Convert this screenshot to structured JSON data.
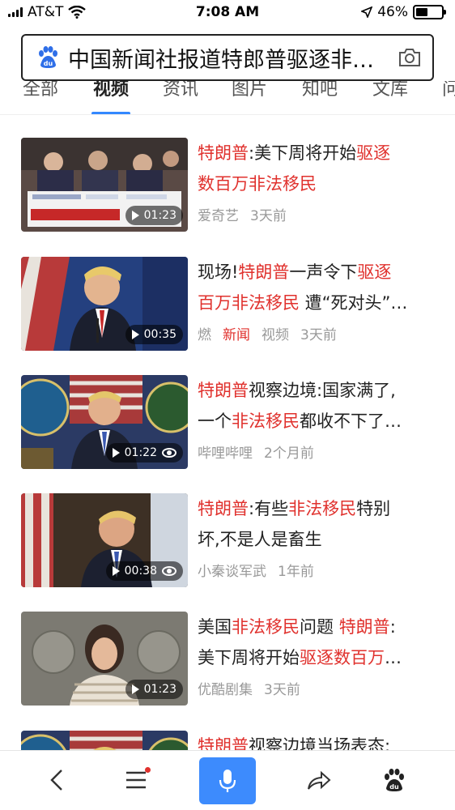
{
  "status": {
    "carrier": "AT&T",
    "time": "7:08 AM",
    "battery": "46%",
    "battery_level": 0.46
  },
  "search": {
    "query": "中国新闻社报道特郎普驱逐非法移民"
  },
  "tabs": [
    {
      "label": "全部"
    },
    {
      "label": "视频",
      "active": true
    },
    {
      "label": "资讯"
    },
    {
      "label": "图片"
    },
    {
      "label": "知吧"
    },
    {
      "label": "文库"
    },
    {
      "label": "问"
    }
  ],
  "results": [
    {
      "title_line1": [
        {
          "t": "特朗普",
          "hl": true
        },
        {
          "t": ":美下周将开始"
        },
        {
          "t": "驱逐",
          "hl": true
        }
      ],
      "title_line2": [
        {
          "t": "数百万非法移民",
          "hl": true
        }
      ],
      "source": "爱奇艺",
      "time": "3天前",
      "duration": "01:23",
      "views_icon": false,
      "thumb_theme": "hall"
    },
    {
      "title_line1": [
        {
          "t": "现场!"
        },
        {
          "t": "特朗普",
          "hl": true
        },
        {
          "t": "一声令下"
        },
        {
          "t": "驱逐",
          "hl": true
        }
      ],
      "title_line2": [
        {
          "t": "百万非法移民",
          "hl": true
        },
        {
          "t": " 遭“死对头”…"
        }
      ],
      "source_parts": [
        {
          "t": "燃"
        },
        {
          "t": "新闻",
          "hl": true
        },
        {
          "t": "视频"
        }
      ],
      "time": "3天前",
      "duration": "00:35",
      "views_icon": false,
      "thumb_theme": "flag-blue"
    },
    {
      "title_line1": [
        {
          "t": "特朗普",
          "hl": true
        },
        {
          "t": "视察边境:国家满了,"
        }
      ],
      "title_line2": [
        {
          "t": "一个"
        },
        {
          "t": "非法移民",
          "hl": true
        },
        {
          "t": "都收不下了…"
        }
      ],
      "source": "哔哩哔哩",
      "time": "2个月前",
      "duration": "01:22",
      "views_icon": true,
      "thumb_theme": "border"
    },
    {
      "title_line1": [
        {
          "t": "特朗普",
          "hl": true
        },
        {
          "t": ":有些"
        },
        {
          "t": "非法移民",
          "hl": true
        },
        {
          "t": "特别"
        }
      ],
      "title_line2": [
        {
          "t": "坏,不是人是畜生"
        }
      ],
      "source": "小秦谈军武",
      "time": "1年前",
      "duration": "00:38",
      "views_icon": true,
      "thumb_theme": "office"
    },
    {
      "title_line1": [
        {
          "t": "美国"
        },
        {
          "t": "非法移民",
          "hl": true
        },
        {
          "t": "问题 "
        },
        {
          "t": "特朗普",
          "hl": true
        },
        {
          "t": ":"
        }
      ],
      "title_line2": [
        {
          "t": "美下周将开始"
        },
        {
          "t": "驱逐数百万",
          "hl": true
        },
        {
          "t": "…"
        }
      ],
      "source": "优酷剧集",
      "time": "3天前",
      "duration": "01:23",
      "views_icon": false,
      "thumb_theme": "podium"
    },
    {
      "title_line1": [
        {
          "t": "特朗普",
          "hl": true
        },
        {
          "t": "视察边境当场表态:"
        }
      ],
      "title_line2": [],
      "source": "",
      "time": "",
      "duration": "",
      "views_icon": false,
      "thumb_theme": "border"
    }
  ],
  "bottom_nav": {
    "back_icon": "chevron-left-icon",
    "menu_icon": "menu-icon",
    "mic_icon": "microphone-icon",
    "share_icon": "share-icon",
    "home_icon": "paw-icon"
  },
  "colors": {
    "highlight": "#e0312d",
    "accent": "#3d8bfd"
  }
}
